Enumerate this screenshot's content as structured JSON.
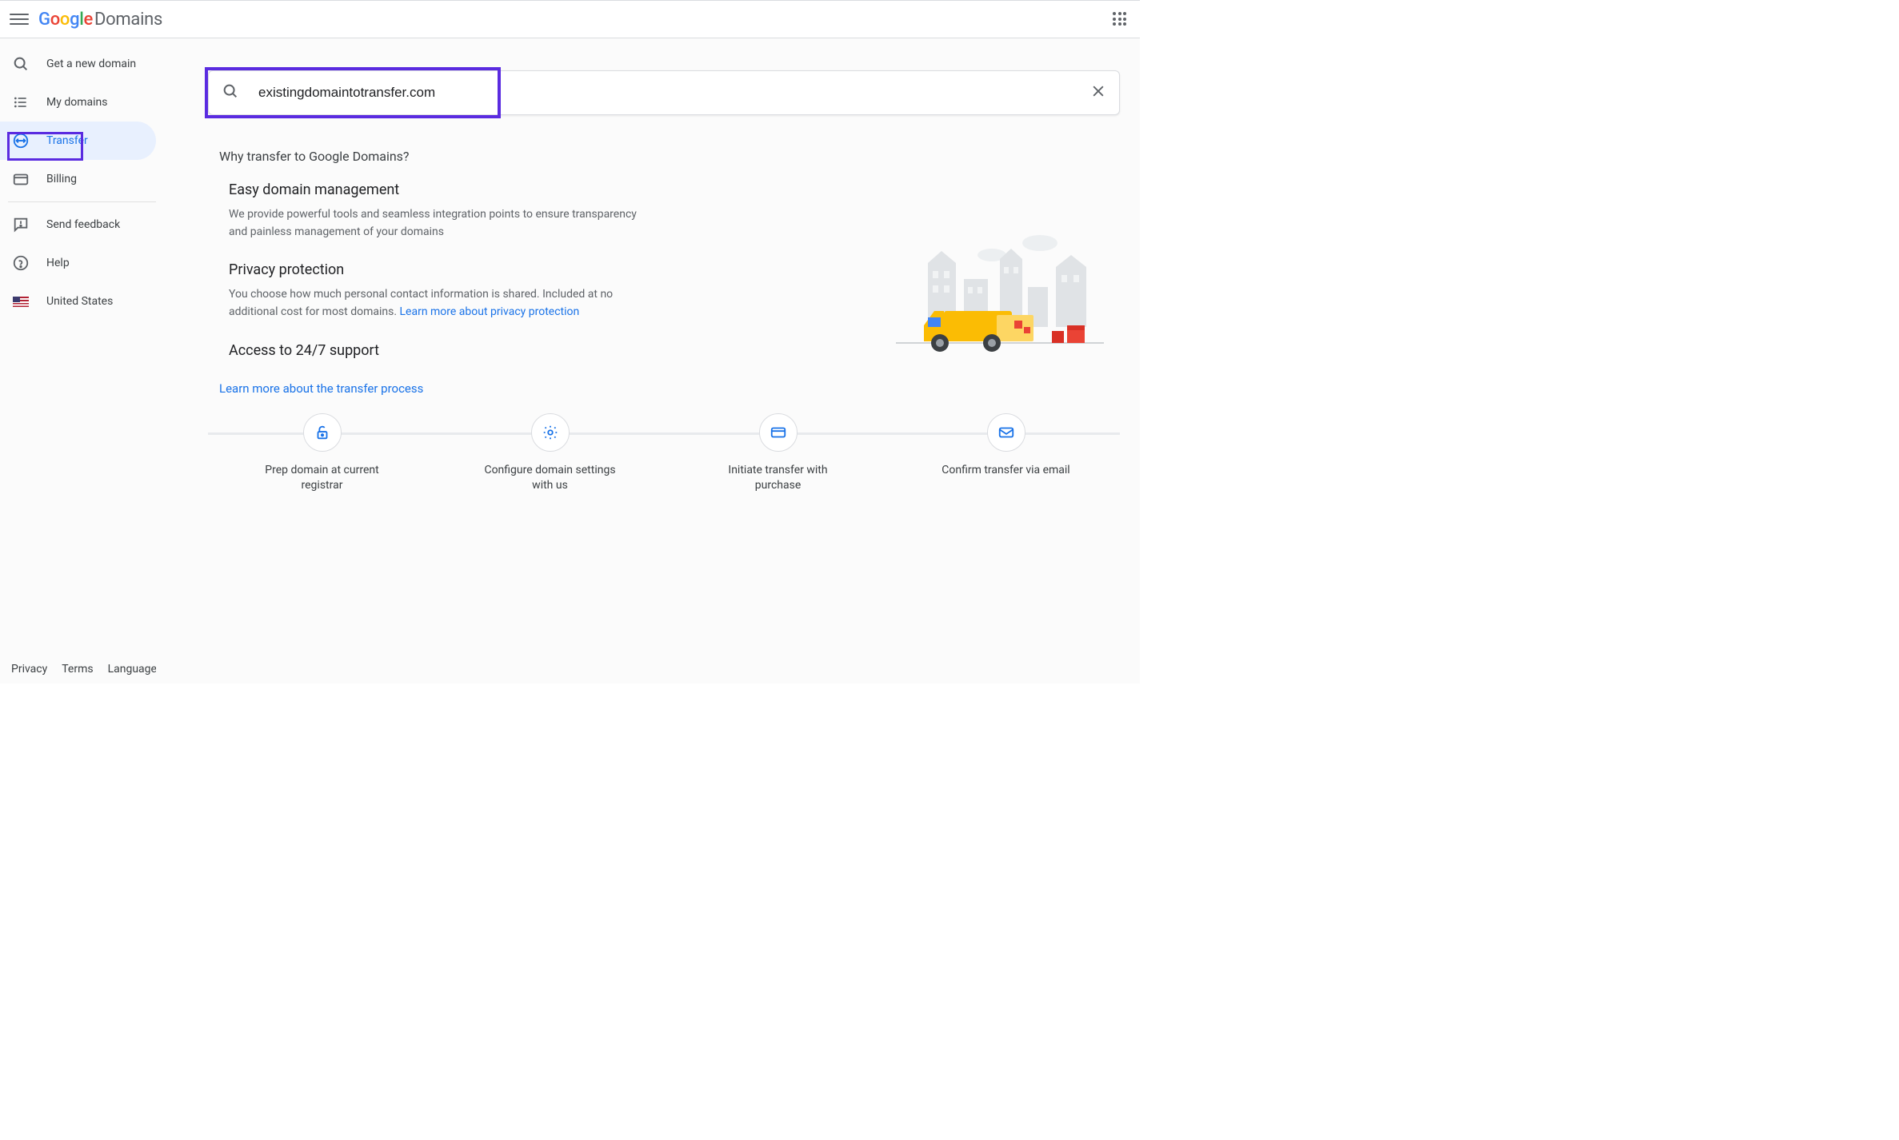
{
  "header": {
    "logo_google": "Google",
    "logo_domains": "Domains"
  },
  "sidebar": {
    "items": [
      {
        "label": "Get a new domain"
      },
      {
        "label": "My domains"
      },
      {
        "label": "Transfer"
      },
      {
        "label": "Billing"
      },
      {
        "label": "Send feedback"
      },
      {
        "label": "Help"
      },
      {
        "label": "United States"
      }
    ]
  },
  "footer": {
    "privacy": "Privacy",
    "terms": "Terms",
    "language": "Language"
  },
  "search": {
    "value": "existingdomaintotransfer.com"
  },
  "main": {
    "why_title": "Why transfer to Google Domains?",
    "benefits": [
      {
        "title": "Easy domain management",
        "body": "We provide powerful tools and seamless integration points to ensure transparency and painless management of your domains"
      },
      {
        "title": "Privacy protection",
        "body_prefix": "You choose how much personal contact information is shared. Included at no additional cost for most domains. ",
        "link": "Learn more about privacy protection"
      },
      {
        "title": "Access to 24/7 support",
        "body": ""
      }
    ],
    "learn_more": "Learn more about the transfer process",
    "steps": [
      "Prep domain at current registrar",
      "Configure domain settings with us",
      "Initiate transfer with purchase",
      "Confirm transfer via email"
    ]
  }
}
